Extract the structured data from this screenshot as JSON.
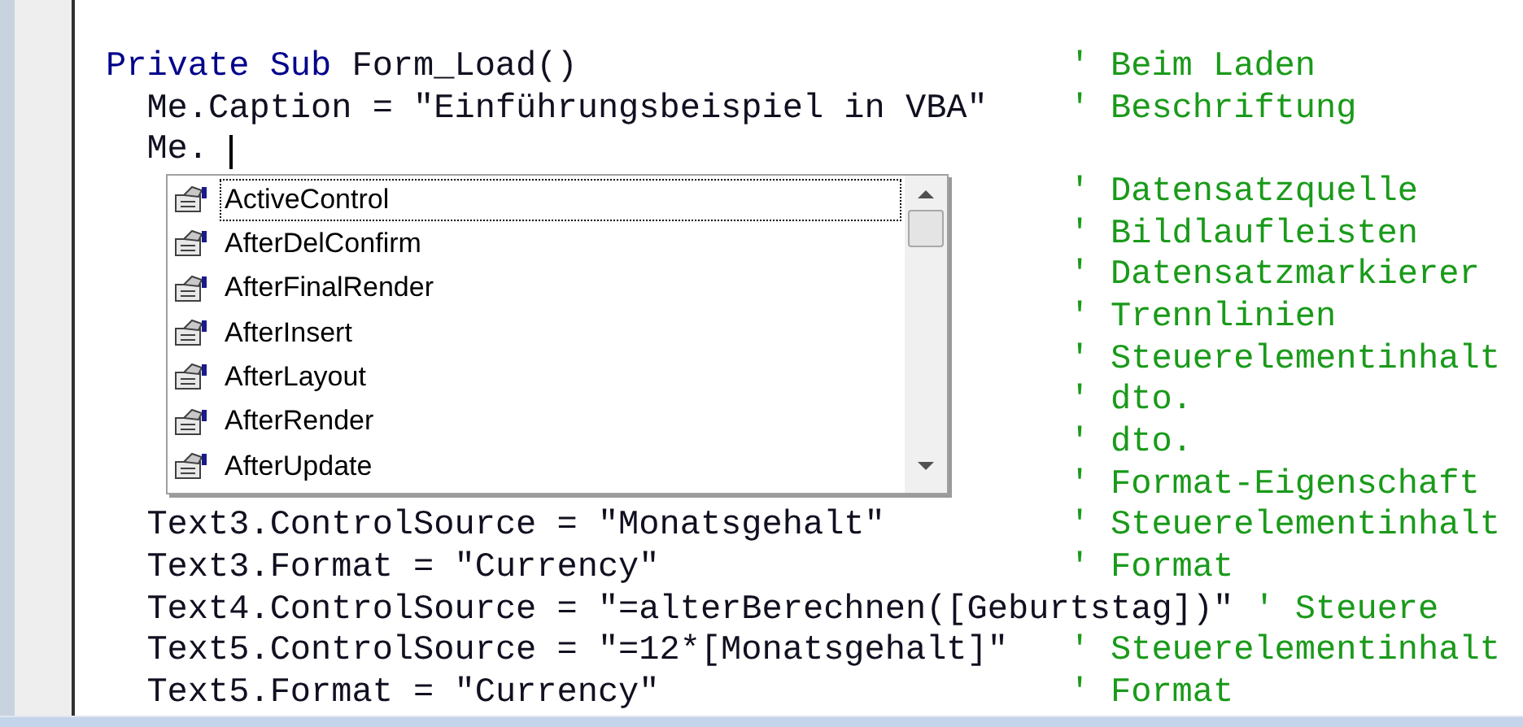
{
  "editor": {
    "lines": [
      {
        "keyword": "Private Sub",
        "code": "Form_Load()",
        "comment": "' Beim Laden",
        "children": [
          {
            "code": "Me.Caption = \"Einführungsbeispiel in VBA\"",
            "comment": "' Beschriftung"
          },
          {
            "code": "Me.",
            "cursor": true
          },
          {
            "comment": "' Datensatzquelle"
          },
          {
            "comment": "' Bildlaufleisten"
          },
          {
            "comment": "' Datensatzmarkierer"
          },
          {
            "comment": "' Trennlinien"
          },
          {
            "comment": "' Steuerelementinhalt"
          },
          {
            "comment": "' dto."
          },
          {
            "comment": "' dto."
          },
          {
            "comment": "' Format-Eigenschaft"
          },
          {
            "code": "Text3.ControlSource = \"Monatsgehalt\"",
            "comment": "' Steuerelementinhalt"
          },
          {
            "code": "Text3.Format = \"Currency\"",
            "comment": "' Format"
          },
          {
            "code": "Text4.ControlSource = \"=alterBerechnen([Geburtstag])\"",
            "comment": "' Steuere"
          },
          {
            "code": "Text5.ControlSource = \"=12*[Monatsgehalt]\"",
            "comment": "' Steuerelementinhalt"
          },
          {
            "code": "Text5.Format = \"Currency\"",
            "comment": "' Format"
          }
        ]
      }
    ]
  },
  "completion_list": {
    "items": [
      {
        "label": "ActiveControl",
        "selected": true
      },
      {
        "label": "AfterDelConfirm",
        "selected": false
      },
      {
        "label": "AfterFinalRender",
        "selected": false
      },
      {
        "label": "AfterInsert",
        "selected": false
      },
      {
        "label": "AfterLayout",
        "selected": false
      },
      {
        "label": "AfterRender",
        "selected": false
      },
      {
        "label": "AfterUpdate",
        "selected": false
      }
    ]
  }
}
